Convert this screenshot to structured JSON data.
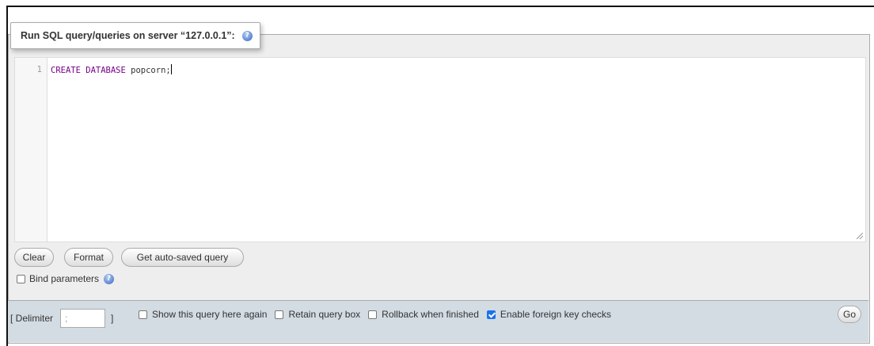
{
  "panel": {
    "title": "Run SQL query/queries on server “127.0.0.1”:",
    "help_icon": "question-circle-icon"
  },
  "editor": {
    "line_numbers": [
      "1"
    ],
    "query": {
      "keyword": "CREATE DATABASE",
      "rest": " popcorn;"
    }
  },
  "buttons": {
    "clear": "Clear",
    "format": "Format",
    "get_autosaved": "Get auto-saved query",
    "go": "Go"
  },
  "bind_parameters": {
    "label": "Bind parameters",
    "checked": false
  },
  "footer": {
    "delimiter_label": "[ Delimiter",
    "delimiter_value": ";",
    "delimiter_close": "]",
    "options": [
      {
        "label": "Show this query here again",
        "checked": false
      },
      {
        "label": "Retain query box",
        "checked": false
      },
      {
        "label": "Rollback when finished",
        "checked": false
      },
      {
        "label": "Enable foreign key checks",
        "checked": true
      }
    ]
  },
  "colors": {
    "footer_bg": "#d3dce3",
    "panel_bg": "#eeeeee",
    "sql_keyword": "#770088",
    "checkbox_checked": "#1a73e8"
  }
}
